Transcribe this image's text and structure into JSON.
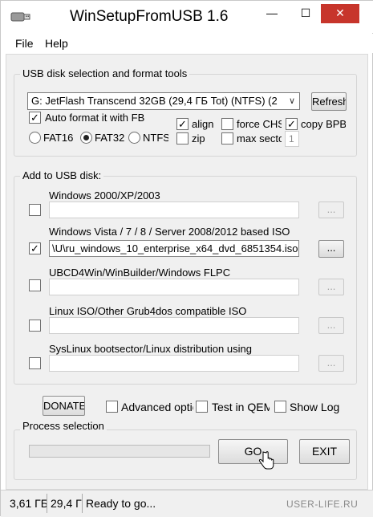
{
  "window": {
    "title": "WinSetupFromUSB 1.6",
    "controls": {
      "minimize": "—",
      "maximize": "☐",
      "close": "✕"
    }
  },
  "menu": [
    "File",
    "Help"
  ],
  "usb_group": {
    "title": "USB disk selection and format tools",
    "disk_selected": "G: JetFlash Transcend 32GB (29,4 ГБ Tot) (NTFS) (2",
    "refresh_label": "Refresh",
    "auto_format_label": "Auto format it with FB",
    "auto_format_checked": true,
    "align_label": "align",
    "align_checked": true,
    "force_chs_label": "force CHS",
    "force_chs_checked": false,
    "copy_bpb_label": "copy BPB",
    "copy_bpb_checked": true,
    "zip_label": "zip",
    "zip_checked": false,
    "max_sectors_label": "max secto",
    "max_sectors_checked": false,
    "max_sectors_value": "1",
    "fs_options": [
      "FAT16",
      "FAT32",
      "NTFS"
    ],
    "fs_selected": "FAT32"
  },
  "add_group": {
    "title": "Add to USB disk:",
    "browse_label": "...",
    "items": [
      {
        "label": "Windows 2000/XP/2003",
        "checked": false,
        "path": ""
      },
      {
        "label": "Windows Vista / 7 / 8 / Server 2008/2012 based ISO",
        "checked": true,
        "path": "\\U\\ru_windows_10_enterprise_x64_dvd_6851354.iso"
      },
      {
        "label": "UBCD4Win/WinBuilder/Windows FLPC",
        "checked": false,
        "path": ""
      },
      {
        "label": "Linux ISO/Other Grub4dos compatible ISO",
        "checked": false,
        "path": ""
      },
      {
        "label": "SysLinux bootsector/Linux distribution using",
        "checked": false,
        "path": ""
      }
    ]
  },
  "options": {
    "donate_label": "DONATE",
    "advanced_label": "Advanced optic",
    "advanced_checked": false,
    "test_qemu_label": "Test in QEM",
    "test_qemu_checked": false,
    "show_log_label": "Show Log",
    "show_log_checked": false
  },
  "process": {
    "title": "Process selection",
    "progress": 0,
    "go_label": "GO",
    "exit_label": "EXIT"
  },
  "status": {
    "free": "3,61 ГБ",
    "total": "29,4 ГБ",
    "message": "Ready to go..."
  },
  "watermark": "USER-LIFE.RU",
  "colors": {
    "close_button": "#c7352b",
    "client_bg": "#f0f0f0",
    "progress_fill": "#06b025"
  }
}
